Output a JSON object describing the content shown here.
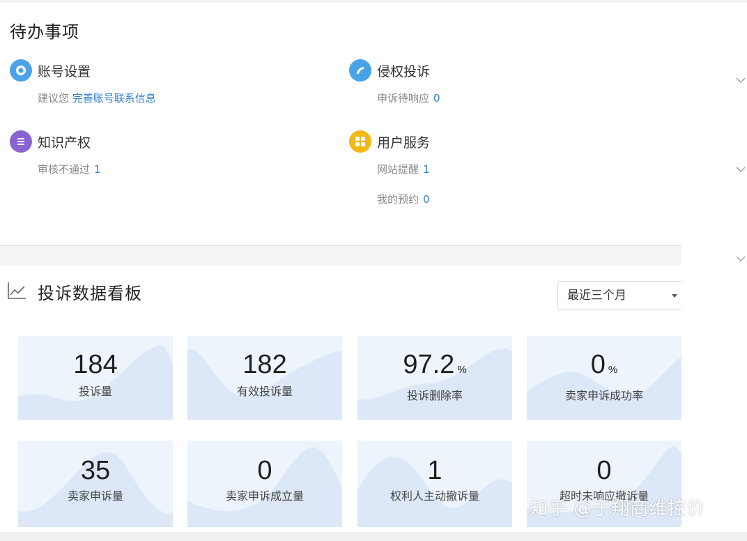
{
  "todo": {
    "title": "待办事项",
    "items": [
      {
        "title": "账号设置",
        "icon": "gear-icon",
        "color": "#4aa3e8",
        "lines": [
          {
            "prefix": "建议您",
            "link": "完善账号联系信息"
          }
        ]
      },
      {
        "title": "侵权投诉",
        "icon": "phone-icon",
        "color": "#4aa3e8",
        "lines": [
          {
            "label": "申诉待响应",
            "count": "0"
          }
        ]
      },
      {
        "title": "知识产权",
        "icon": "list-icon",
        "color": "#8a63d2",
        "lines": [
          {
            "label": "审核不通过",
            "count": "1"
          }
        ]
      },
      {
        "title": "用户服务",
        "icon": "grid-icon",
        "color": "#f2b718",
        "lines": [
          {
            "label": "网站提醒",
            "count": "1"
          },
          {
            "label": "我的预约",
            "count": "0"
          }
        ]
      }
    ]
  },
  "dashboard": {
    "title": "投诉数据看板",
    "period": "最近三个月",
    "stats": [
      {
        "value": "184",
        "unit": "",
        "label": "投诉量"
      },
      {
        "value": "182",
        "unit": "",
        "label": "有效投诉量"
      },
      {
        "value": "97.2",
        "unit": "%",
        "label": "投诉删除率"
      },
      {
        "value": "0",
        "unit": "%",
        "label": "卖家申诉成功率"
      },
      {
        "value": "35",
        "unit": "",
        "label": "卖家申诉量"
      },
      {
        "value": "0",
        "unit": "",
        "label": "卖家申诉成立量"
      },
      {
        "value": "1",
        "unit": "",
        "label": "权利人主动撤诉量"
      },
      {
        "value": "0",
        "unit": "",
        "label": "超时未响应撤诉量"
      }
    ]
  },
  "watermark": "知乎 @于翔商维控价",
  "colors": {
    "accent": "#2f7fd1",
    "card_bg": "#eef4fc",
    "wave": "#dce8f7"
  }
}
